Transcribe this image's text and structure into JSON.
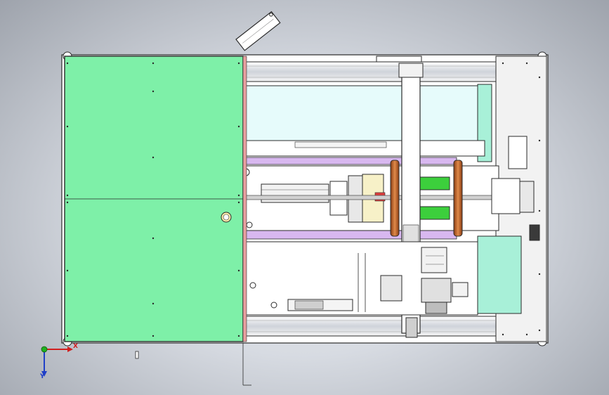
{
  "viewport": {
    "background": "gradient-grey"
  },
  "model": {
    "description_icons": [
      "machine-frame",
      "green-cover-panel",
      "rail",
      "spindle-assembly",
      "rotary-ring",
      "motor",
      "control-box"
    ],
    "colors": {
      "cover": "#7ef0a8",
      "cover_edge": "#2a6a40",
      "frame": "#ffffff",
      "line": "#2b2b2b",
      "purple_strip": "#d8b8f0",
      "light_cyan": "#e6fbfb",
      "copper": "#c86a2a",
      "green_part": "#3ccf3c",
      "red_part": "#e04040",
      "teal_panel": "#a8f0d8",
      "grey_part": "#bdbdbd",
      "pink_edge": "#e8a0a0"
    }
  },
  "triad": {
    "x_label": "X",
    "y_label": "Y",
    "x_color": "#d12020",
    "y_color": "#2040c8",
    "z_color": "#20b020"
  }
}
